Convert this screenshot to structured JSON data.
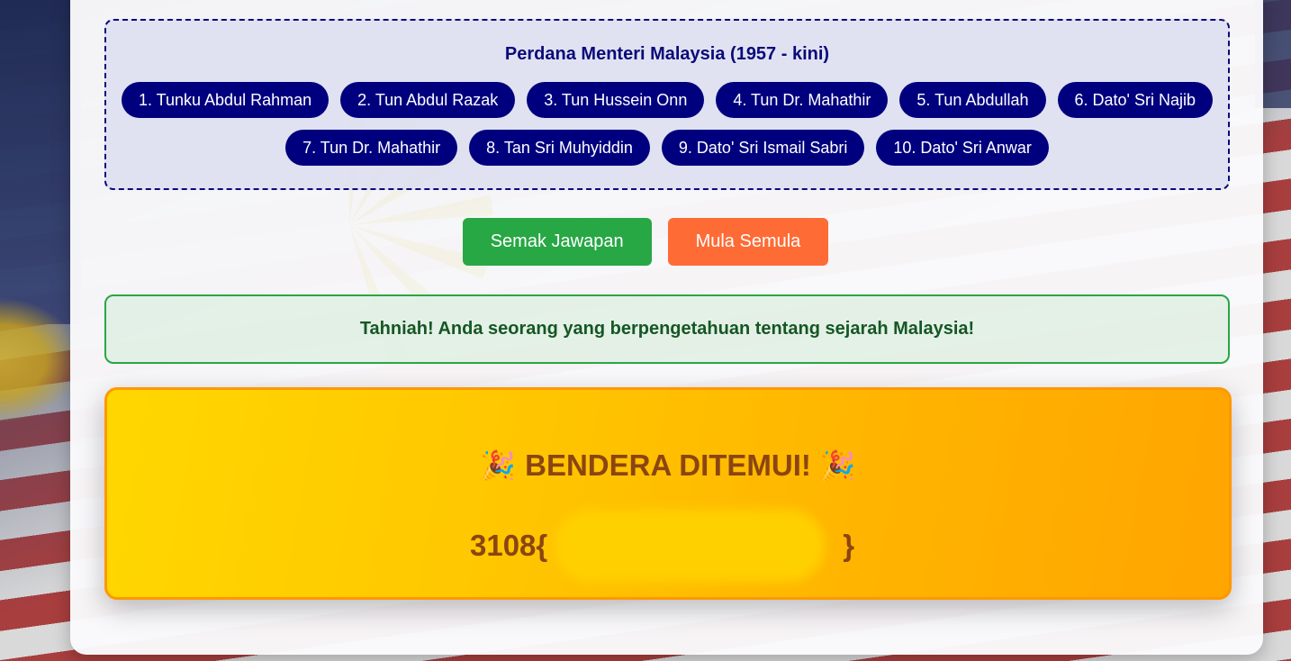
{
  "pm_section": {
    "title": "Perdana Menteri Malaysia (1957 - kini)",
    "row1": [
      "1. Tunku Abdul Rahman",
      "2. Tun Abdul Razak",
      "3. Tun Hussein Onn",
      "4. Tun Dr. Mahathir",
      "5. Tun Abdullah",
      "6. Dato' Sri Najib"
    ],
    "row2": [
      "7. Tun Dr. Mahathir",
      "8. Tan Sri Muhyiddin",
      "9. Dato' Sri Ismail Sabri",
      "10. Dato' Sri Anwar"
    ]
  },
  "buttons": {
    "check_label": "Semak Jawapan",
    "restart_label": "Mula Semula"
  },
  "result": {
    "message": "Tahniah! Anda seorang yang berpengetahuan tentang sejarah Malaysia!"
  },
  "flag": {
    "emoji": "🎉",
    "title": "BENDERA DITEMUI!",
    "prefix": "3108{",
    "suffix": "}"
  },
  "colors": {
    "pill_bg": "#00007f",
    "check_button": "#28a745",
    "restart_button": "#ff6b35",
    "flag_border": "#ff9800",
    "flag_text": "#8b4513"
  }
}
